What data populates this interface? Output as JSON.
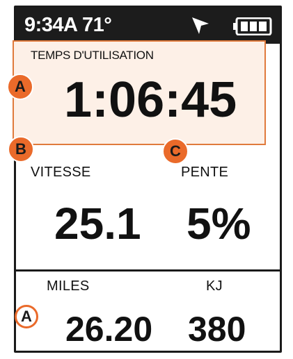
{
  "status_bar": {
    "time_temp": "9:34A 71°",
    "nav_icon": "navigation-arrow-icon",
    "battery_icon": "battery-full-icon"
  },
  "fields": {
    "timer": {
      "label": "TEMPS D'UTILISATION",
      "value": "1:06:45"
    },
    "speed": {
      "label": "VITESSE",
      "value": "25.1"
    },
    "grade": {
      "label": "PENTE",
      "value": "5%"
    },
    "distance": {
      "label": "MILES",
      "value": "26.20"
    },
    "energy": {
      "label": "KJ",
      "value": "380"
    }
  },
  "callouts": {
    "timer_field": "A",
    "speed_field": "B",
    "grade_field": "C",
    "bottom_fields": "A"
  },
  "colors": {
    "accent": "#ea6a2a",
    "highlight_border": "#e07a3c",
    "status_bar_bg": "#1c1c1c"
  }
}
